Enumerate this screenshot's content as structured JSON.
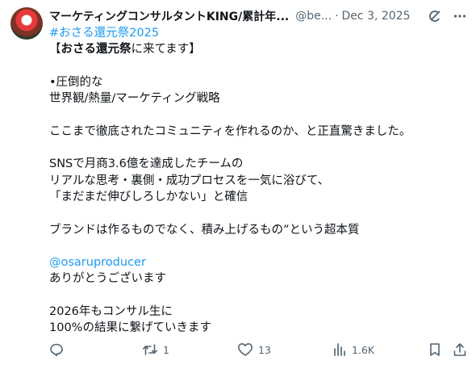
{
  "author": {
    "display_name": "マーケティングコンサルタントKING/累計年...",
    "handle": "@be...",
    "separator": "·",
    "date": "Dec 3, 2025"
  },
  "body": {
    "hashtag": "#おさる還元祭2025",
    "heading_open": "【",
    "heading_bold": "おさる還元祭",
    "heading_rest": "に来てます】",
    "l_bullet": "•圧倒的な",
    "l_world": "世界観/熱量/マーケティング戦略",
    "l_community": "ここまで徹底されたコミュニティを作れるのか、と正直驚きました。",
    "l_sns": "SNSで月商3.6億を達成したチームの",
    "l_real": "リアルな思考・裏側・成功プロセスを一気に浴びて、",
    "l_mada": "「まだまだ伸びしろしかない」と確信",
    "l_brand": "ブランドは作るものでなく、積み上げるもの”という超本質",
    "mention": "@osaruproducer",
    "l_thanks": "ありがとうございます",
    "l_2026": "2026年もコンサル生に",
    "l_100": "100%の結果に繋げていきます"
  },
  "actions": {
    "reposts": "1",
    "likes": "13",
    "views": "1.6K"
  },
  "colors": {
    "text": "#0f1419",
    "muted": "#536471",
    "link": "#1d9bf0"
  }
}
